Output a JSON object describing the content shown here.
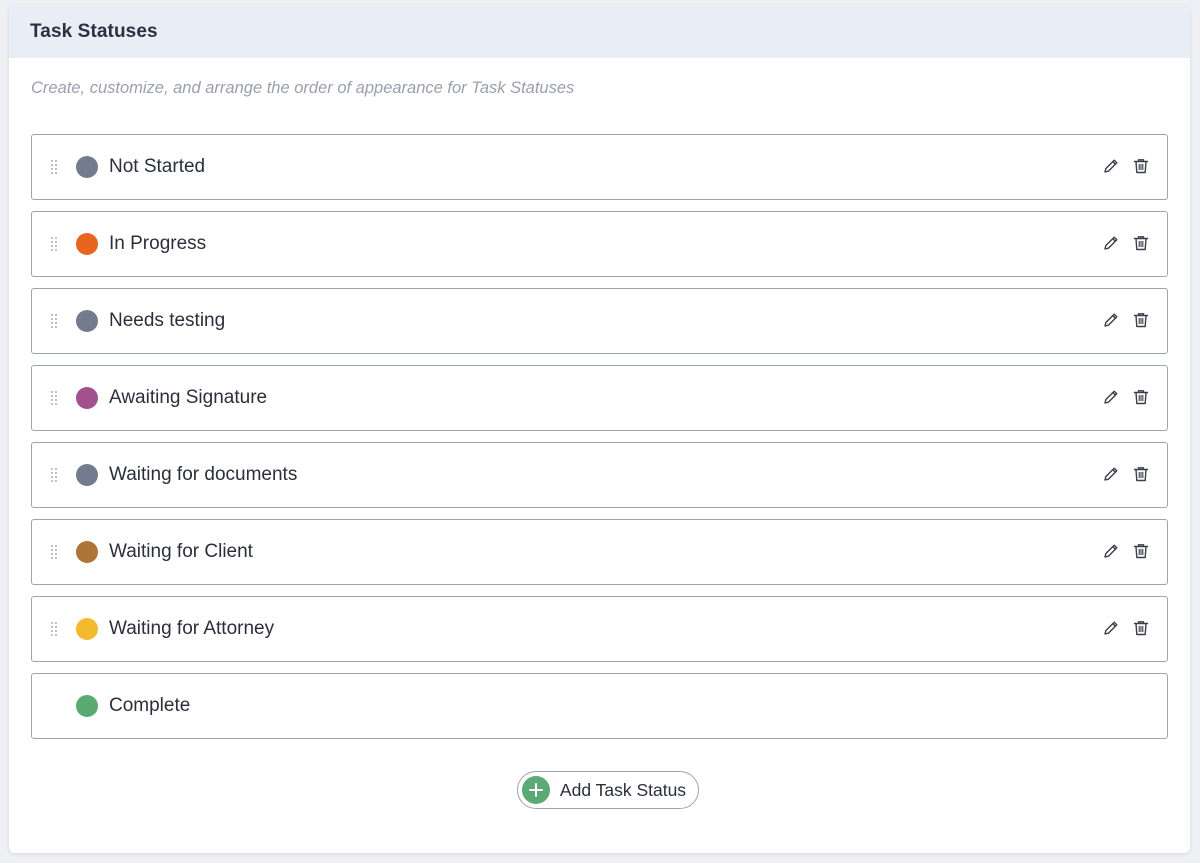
{
  "header": {
    "title": "Task Statuses"
  },
  "description": "Create, customize, and arrange the order of appearance for Task Statuses",
  "statuses": [
    {
      "label": "Not Started",
      "color": "#737c8e",
      "draggable": true,
      "editable": true
    },
    {
      "label": "In Progress",
      "color": "#e8651f",
      "draggable": true,
      "editable": true
    },
    {
      "label": "Needs testing",
      "color": "#737c8e",
      "draggable": true,
      "editable": true
    },
    {
      "label": "Awaiting Signature",
      "color": "#a3508f",
      "draggable": true,
      "editable": true
    },
    {
      "label": "Waiting for documents",
      "color": "#737c8e",
      "draggable": true,
      "editable": true
    },
    {
      "label": "Waiting for Client",
      "color": "#ad7538",
      "draggable": true,
      "editable": true
    },
    {
      "label": "Waiting for Attorney",
      "color": "#f2bb2e",
      "draggable": true,
      "editable": true
    },
    {
      "label": "Complete",
      "color": "#5caa73",
      "draggable": false,
      "editable": false
    }
  ],
  "icons": {
    "drag": "drag-handle-icon",
    "edit": "pencil-icon",
    "delete": "trash-icon",
    "add": "plus-circle-icon"
  },
  "add_button": {
    "label": "Add Task Status",
    "accent": "#5caa73"
  }
}
